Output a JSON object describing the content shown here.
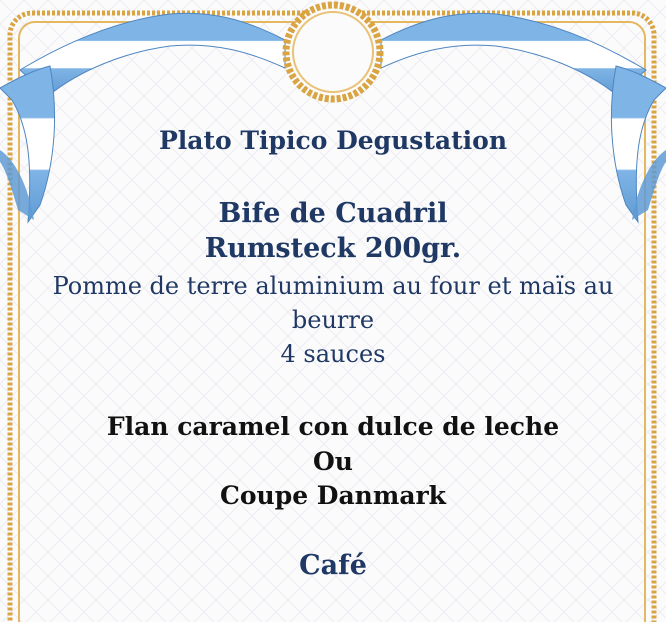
{
  "menu": {
    "title": "Plato Tipico Degustation",
    "main_course_line1": "Bife de Cuadril",
    "main_course_line2": "Rumsteck 200gr.",
    "sides_line1": "Pomme de terre aluminium au four et maïs au",
    "sides_line2": "beurre",
    "sides_line3": "4 sauces",
    "dessert_line1": "Flan caramel con dulce de leche",
    "dessert_line2": "Ou",
    "dessert_line3": "Coupe Danmark",
    "coffee": "Café"
  },
  "colors": {
    "navy_text": "#1f3864",
    "black_text": "#111111",
    "gold_frame": "#d9a441",
    "ribbon_blue": "#7fb4e6",
    "ribbon_white": "#ffffff"
  }
}
